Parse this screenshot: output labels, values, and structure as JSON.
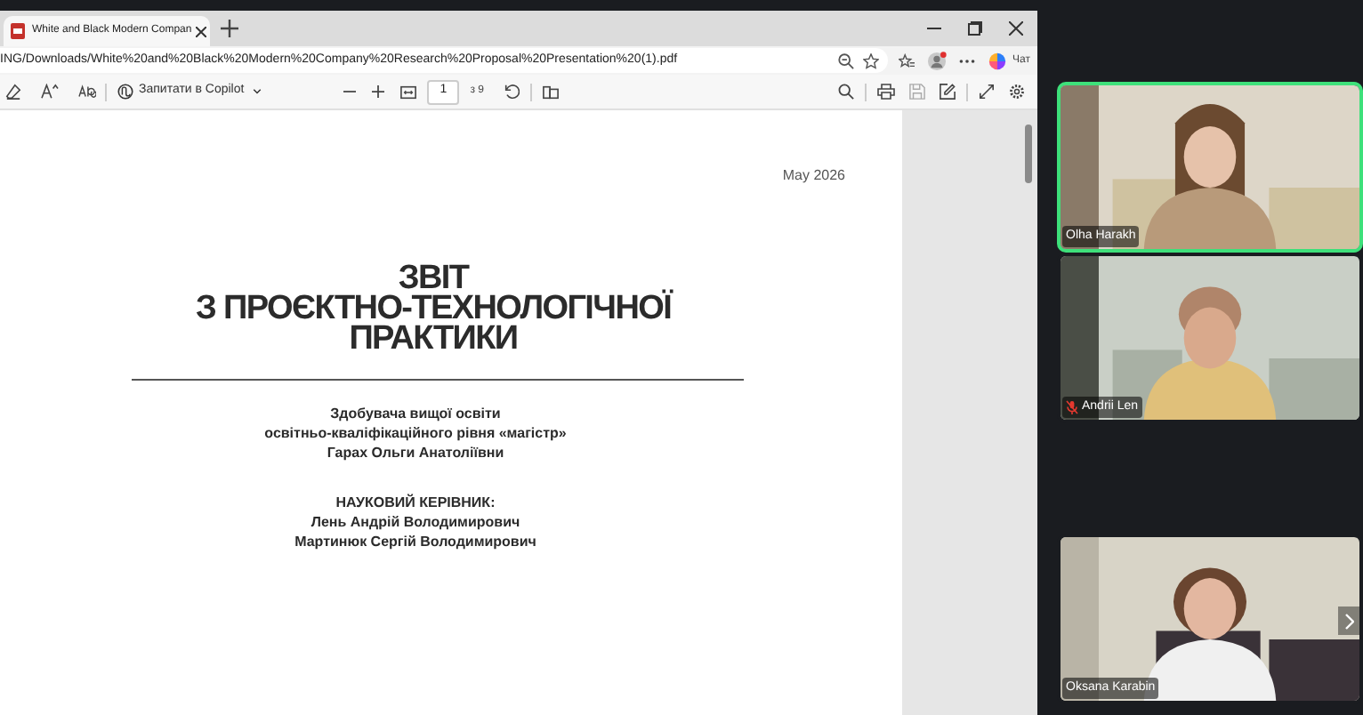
{
  "browser": {
    "tabs": [
      {
        "title": "White and Black Modern Compan",
        "selected": true
      }
    ],
    "address": "ING/Downloads/White%20and%20Black%20Modern%20Company%20Research%20Proposal%20Presentation%20(1).pdf",
    "chat_button": "Чат",
    "pdf_toolbar": {
      "copilot_button": "Запитати в Copilot",
      "page": "1",
      "page_count": "з 9"
    }
  },
  "document": {
    "date": "May 2026",
    "title": [
      "ЗВІТ",
      "З ПРОЄКТНО-ТЕХНОЛОГІЧНОЇ",
      "ПРАКТИКИ"
    ],
    "author": [
      "Здобувача вищої освіти",
      "освітньо-кваліфікаційного рівня «магістр»",
      "Гарах Ольги Анатоліївни"
    ],
    "supervisor": [
      "НАУКОВИЙ КЕРІВНИК:",
      "Лень Андрій Володимирович",
      "Мартинюк Сергій Володимирович"
    ]
  },
  "participants": [
    {
      "name": "Olha Harakh",
      "speaking": true,
      "muted": false
    },
    {
      "name": "Andrii Len",
      "speaking": false,
      "muted": true
    },
    {
      "name": "Oksana Karabin",
      "speaking": false,
      "muted": false
    }
  ]
}
